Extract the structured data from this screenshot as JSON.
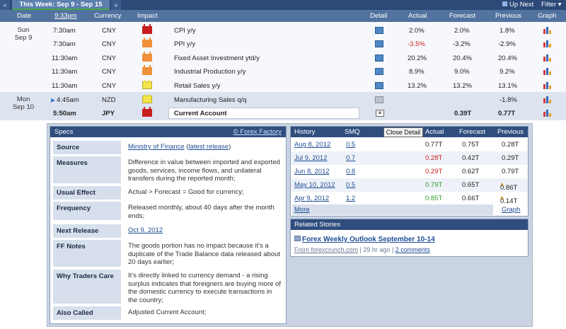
{
  "topbar": {
    "prev_label": "«",
    "week_label": "This Week: Sep 9 - Sep 15",
    "next_label": "»",
    "up_next_label": "Up Next",
    "filter_label": "Filter"
  },
  "columns": {
    "date": "Date",
    "time": "9:33pm",
    "currency": "Currency",
    "impact": "Impact",
    "detail": "Detail",
    "actual": "Actual",
    "forecast": "Forecast",
    "previous": "Previous",
    "graph": "Graph"
  },
  "days": [
    {
      "weekday": "Sun",
      "date": "Sep 9"
    },
    {
      "weekday": "Mon",
      "date": "Sep 10"
    }
  ],
  "events": [
    {
      "time": "7:30am",
      "currency": "CNY",
      "impact": "red",
      "name": "CPI y/y",
      "actual": "2.0%",
      "forecast": "2.0%",
      "previous": "1.8%"
    },
    {
      "time": "7:30am",
      "currency": "CNY",
      "impact": "orange",
      "name": "PPI y/y",
      "actual": "-3.5%",
      "forecast": "-3.2%",
      "previous": "-2.9%"
    },
    {
      "time": "11:30am",
      "currency": "CNY",
      "impact": "orange",
      "name": "Fixed Asset Investment ytd/y",
      "actual": "20.2%",
      "forecast": "20.4%",
      "previous": "20.4%"
    },
    {
      "time": "11:30am",
      "currency": "CNY",
      "impact": "orange",
      "name": "Industrial Production y/y",
      "actual": "8.9%",
      "forecast": "9.0%",
      "previous": "9.2%"
    },
    {
      "time": "11:30am",
      "currency": "CNY",
      "impact": "yellow",
      "name": "Retail Sales y/y",
      "actual": "13.2%",
      "forecast": "13.2%",
      "previous": "13.1%"
    },
    {
      "time": "4:45am",
      "currency": "NZD",
      "impact": "yellow",
      "name": "Manufacturing Sales q/q",
      "actual": "",
      "forecast": "",
      "previous": "-1.8%"
    },
    {
      "time": "5:50am",
      "currency": "JPY",
      "impact": "red",
      "name": "Current Account",
      "actual": "",
      "forecast": "0.39T",
      "previous": "0.77T"
    }
  ],
  "specs": {
    "title": "Specs",
    "credit": "© Forex Factory",
    "rows": [
      {
        "label": "Source",
        "value": "Ministry of Finance",
        "extra": "latest release"
      },
      {
        "label": "Measures",
        "value": "Difference in value between imported and exported goods, services, income flows, and unilateral transfers during the reported month;"
      },
      {
        "label": "Usual Effect",
        "value": "Actual > Forecast = Good for currency;"
      },
      {
        "label": "Frequency",
        "value": "Released monthly, about 40 days after the month ends;"
      },
      {
        "label": "Next Release",
        "value": "Oct 9, 2012"
      },
      {
        "label": "FF Notes",
        "value": "The goods portion has no impact because it's a duplicate of the Trade Balance data released about 20 days earlier;"
      },
      {
        "label": "Why Traders Care",
        "value": "It's directly linked to currency demand - a rising surplus indicates that foreigners are buying more of the domestic currency to execute transactions in the country;"
      },
      {
        "label": "Also Called",
        "value": "Adjusted Current Account;"
      }
    ]
  },
  "history": {
    "headers": {
      "history": "History",
      "smq": "SMQ",
      "actual": "Actual",
      "forecast": "Forecast",
      "previous": "Previous"
    },
    "tooltip": "Close Detail",
    "rows": [
      {
        "date": "Aug 8, 2012",
        "smq": "0.5",
        "actual": "0.77T",
        "actual_color": "#222222",
        "forecast": "0.75T",
        "previous": "0.28T"
      },
      {
        "date": "Jul 9, 2012",
        "smq": "0.7",
        "actual": "0.28T",
        "actual_color": "#cc1f1f",
        "forecast": "0.42T",
        "previous": "0.29T"
      },
      {
        "date": "Jun 8, 2012",
        "smq": "0.8",
        "actual": "0.29T",
        "actual_color": "#cc1f1f",
        "forecast": "0.62T",
        "previous": "0.79T"
      },
      {
        "date": "May 10, 2012",
        "smq": "0.5",
        "actual": "0.79T",
        "actual_color": "#2c9a2c",
        "forecast": "0.65T",
        "previous": "0.86T"
      },
      {
        "date": "Apr 9, 2012",
        "smq": "1.2",
        "actual": "0.85T",
        "actual_color": "#2c9a2c",
        "forecast": "0.66T",
        "previous": "0.14T"
      }
    ],
    "more_label": "More",
    "graph_label": "Graph"
  },
  "related": {
    "title": "Related Stories",
    "story_title": "Forex Weekly Outlook September 10-14",
    "source": "From forexcrunch.com",
    "age": "29 hr ago",
    "comments": "2 comments"
  }
}
